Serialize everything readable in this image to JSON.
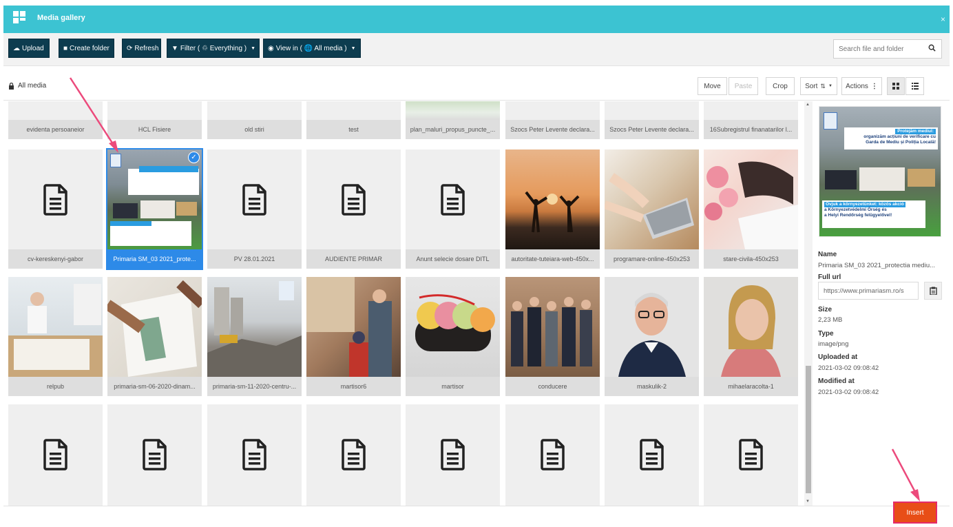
{
  "header": {
    "title": "Media gallery",
    "close_glyph": "×"
  },
  "toolbar": {
    "upload": "Upload",
    "create_folder": "Create folder",
    "refresh": "Refresh",
    "filter": "Filter ( ♲ Everything )",
    "view_in": "View in ( 🌐 All media )",
    "search_placeholder": "Search file and folder"
  },
  "breadcrumb": {
    "label": "All media"
  },
  "actions": {
    "move": "Move",
    "paste": "Paste",
    "crop": "Crop",
    "sort": "Sort",
    "actions": "Actions"
  },
  "grid": {
    "row1": [
      "evidenta persoaneior",
      "HCL Fisiere",
      "old stiri",
      "test",
      "plan_maluri_propus_puncte_...",
      "Szocs Peter Levente declara...",
      "Szocs Peter Levente declara...",
      "16Subregistrul finanatarilor l..."
    ],
    "row2": [
      "cv-kereskenyi-gabor",
      "Primaria SM_03 2021_prote...",
      "PV 28.01.2021",
      "AUDIENTE PRIMAR",
      "Anunt selecie dosare DITL",
      "autoritate-tuteiara-web-450x...",
      "programare-online-450x253",
      "stare-civila-450x253"
    ],
    "row3": [
      "relpub",
      "primaria-sm-06-2020-dinam...",
      "primaria-sm-11-2020-centru-...",
      "martisor6",
      "martisor",
      "conducere",
      "maskulik-2",
      "mihaelaracolta-1"
    ]
  },
  "preview_text": {
    "line1": "Protejăm mediul:",
    "line2": "organizăm acțiuni de verificare cu",
    "line3": "Garda de Mediu și Poliția Locală!",
    "line4": "Óvjuk a környezetünket: közös akció",
    "line5": "a Környezetvédelmi Őrség és",
    "line6": "a Helyi Rendőrség felügyelővel!"
  },
  "details": {
    "name_label": "Name",
    "name_value": "Primaria SM_03 2021_protectia mediu...",
    "url_label": "Full url",
    "url_value": "https://www.primariasm.ro/s",
    "size_label": "Size",
    "size_value": "2,23 MB",
    "type_label": "Type",
    "type_value": "image/png",
    "uploaded_label": "Uploaded at",
    "uploaded_value": "2021-03-02 09:08:42",
    "modified_label": "Modified at",
    "modified_value": "2021-03-02 09:08:42"
  },
  "footer": {
    "insert": "Insert"
  },
  "colors": {
    "header": "#3cc3d2",
    "dark_button": "#0d3c4f",
    "selected": "#2d8ae8",
    "insert": "#e84e17",
    "arrow": "#ec4a7c"
  }
}
